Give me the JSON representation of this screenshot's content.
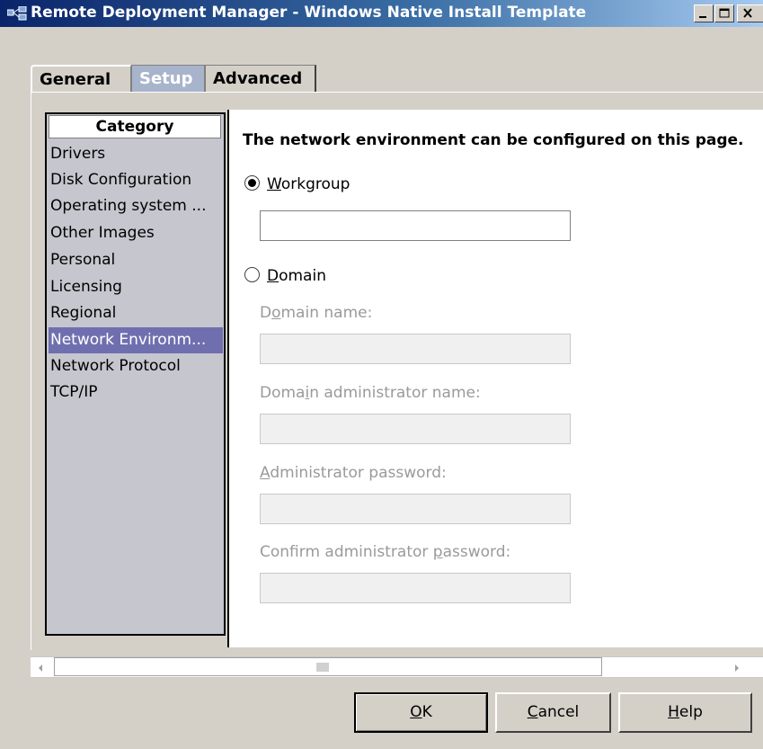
{
  "window": {
    "title": "Remote Deployment Manager - Windows Native Install Template",
    "icon": "app-network-icon"
  },
  "tabs": [
    {
      "label": "General"
    },
    {
      "label": "Setup",
      "selected": true
    },
    {
      "label": "Advanced"
    }
  ],
  "category": {
    "header": "Category",
    "items": [
      {
        "label": "Drivers"
      },
      {
        "label": "Disk Configuration"
      },
      {
        "label": "Operating system ..."
      },
      {
        "label": "Other Images"
      },
      {
        "label": "Personal"
      },
      {
        "label": "Licensing"
      },
      {
        "label": "Regional"
      },
      {
        "label": "Network Environm...",
        "selected": true
      },
      {
        "label": "Network Protocol"
      },
      {
        "label": "TCP/IP"
      }
    ]
  },
  "page": {
    "heading": "The network environment can be configured on this page.",
    "workgroup_radio": {
      "mnemonic": "W",
      "rest": "orkgroup",
      "checked": true
    },
    "workgroup_value": "",
    "domain_radio": {
      "mnemonic": "D",
      "rest": "omain",
      "checked": false
    },
    "domain_name_label": {
      "pre": "D",
      "mnemonic": "o",
      "post": "main name:"
    },
    "domain_admin_label": {
      "pre": "Doma",
      "mnemonic": "i",
      "post": "n administrator name:"
    },
    "admin_password_label": {
      "pre": "",
      "mnemonic": "A",
      "post": "dministrator password:"
    },
    "confirm_password_label": {
      "pre": "Confirm administrator ",
      "mnemonic": "p",
      "post": "assword:"
    },
    "domain_name_value": "",
    "domain_admin_value": "",
    "admin_password_value": "",
    "confirm_password_value": ""
  },
  "buttons": {
    "ok": {
      "mnemonic": "O",
      "rest": "K"
    },
    "cancel": {
      "mnemonic": "C",
      "rest": "ancel"
    },
    "help": {
      "mnemonic": "H",
      "rest": "elp"
    }
  },
  "colors": {
    "selection": "#6f6fb0",
    "tab_selected": "#a8b4cc",
    "title_gradient_start": "#0a246a"
  }
}
